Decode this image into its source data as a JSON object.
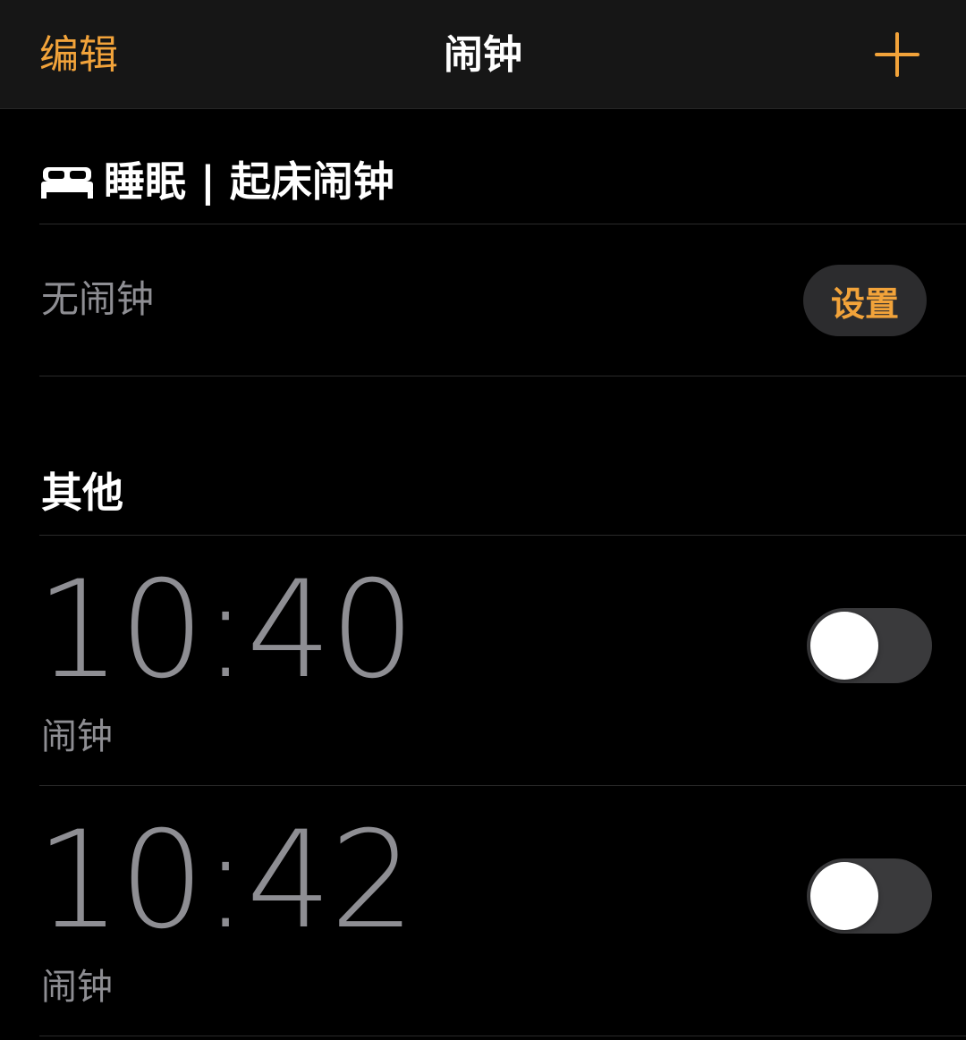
{
  "nav": {
    "edit_label": "编辑",
    "title": "闹钟",
    "add_icon": "plus-icon"
  },
  "sleep": {
    "icon": "bed-icon",
    "title": "睡眠 | 起床闹钟",
    "empty_text": "无闹钟",
    "setup_label": "设置"
  },
  "other": {
    "title": "其他",
    "alarms": [
      {
        "time": "10:40",
        "label": "闹钟",
        "enabled": false
      },
      {
        "time": "10:42",
        "label": "闹钟",
        "enabled": false
      }
    ]
  },
  "colors": {
    "accent": "#f2a33a",
    "background": "#000000",
    "navbar": "#161616",
    "secondary_text": "#8e8e93",
    "toggle_off": "#3a3a3c",
    "button_bg": "#2c2c2e"
  }
}
